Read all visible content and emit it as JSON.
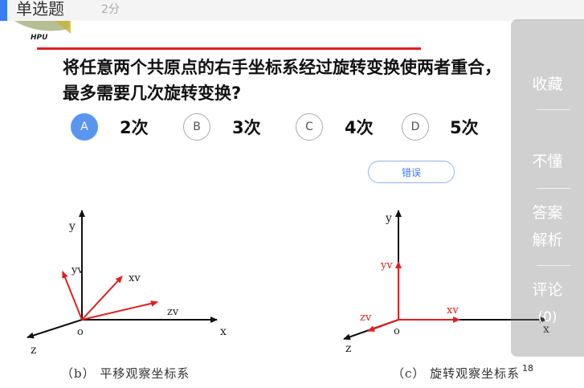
{
  "header": {
    "question_type": "单选题",
    "score": "2分"
  },
  "logo": {
    "text": "HPU"
  },
  "question": {
    "text": "将任意两个共原点的右手坐标系经过旋转变换使两者重合，最多需要几次旋转变换?"
  },
  "options": [
    {
      "letter": "A",
      "text": "2次",
      "selected": true
    },
    {
      "letter": "B",
      "text": "3次",
      "selected": false
    },
    {
      "letter": "C",
      "text": "4次",
      "selected": false
    },
    {
      "letter": "D",
      "text": "5次",
      "selected": false
    }
  ],
  "error_button": "错误",
  "figure": {
    "left": {
      "caption": "（b） 平移观察坐标系",
      "labels": {
        "y": "y",
        "x": "x",
        "z": "z",
        "o": "o",
        "yv": "yv",
        "xv": "xv",
        "zv": "zv"
      }
    },
    "right": {
      "caption": "（c） 旋转观察坐标系",
      "labels": {
        "y": "y",
        "x": "x",
        "z": "z",
        "o": "o",
        "yv": "yv",
        "xv": "xv",
        "zv": "zv"
      }
    }
  },
  "side_panel": {
    "items": [
      "收藏",
      "不懂",
      "答案",
      "解析",
      "评论",
      "(0)"
    ]
  },
  "page_number": "18",
  "colors": {
    "accent": "#3b7df2",
    "selected": "#5a96f0",
    "red": "#e02020"
  }
}
